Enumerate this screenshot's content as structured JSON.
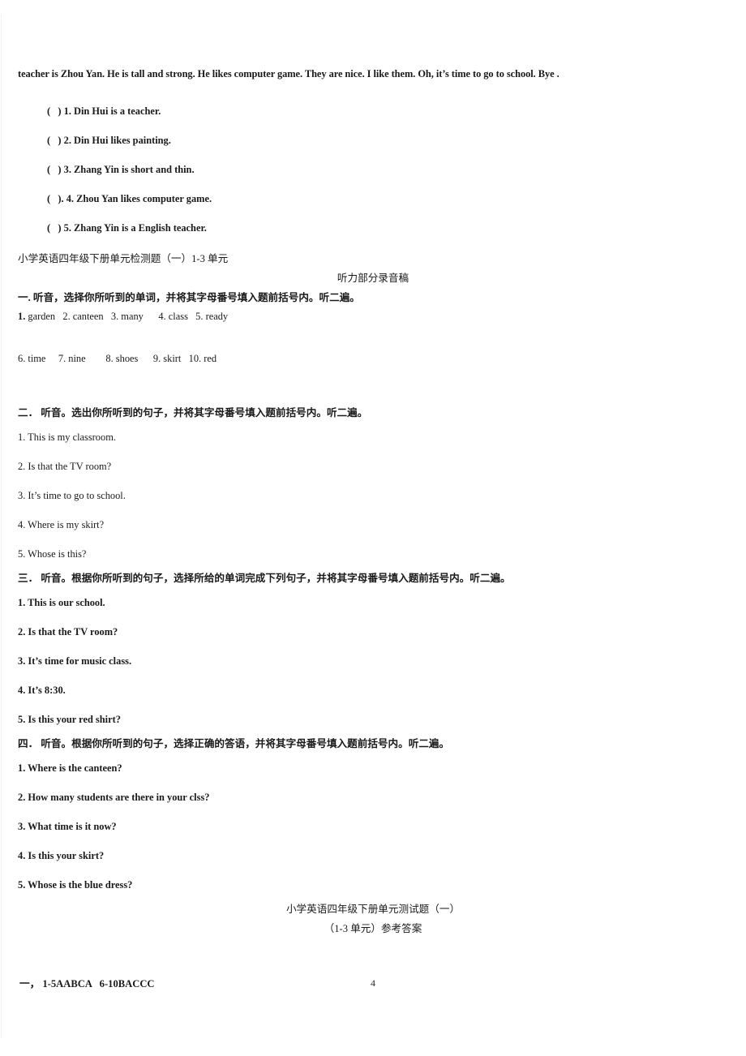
{
  "document": {
    "page_number": "4"
  },
  "passage": {
    "tail_line": "teacher is Zhou Yan. He is tall and strong. He likes computer game. They are nice. I like them. Oh, it’s time to go to school. Bye ."
  },
  "true_false": {
    "items": [
      "(   ) 1. Din Hui is a teacher.",
      "(   ) 2. Din Hui likes painting.",
      "(   ) 3. Zhang Yin is short and thin.",
      "(   ). 4. Zhou Yan likes computer game.",
      "(   ) 5. Zhang Yin is a English teacher."
    ]
  },
  "worksheet": {
    "title": "小学英语四年级下册单元检测题（一）1-3 单元",
    "script_header": "听力部分录音稿"
  },
  "sections": [
    {
      "id": "section-one",
      "directive": "一. 听音，选择你所听到的单词，并将其字母番号填入题前括号内。听二遍。",
      "word_rows": [
        {
          "lead": "1.",
          "rest": " garden   2. canteen   3. many      4. class   5. ready"
        },
        {
          "lead": "",
          "rest": "6. time     7. nine        8. shoes      9. skirt   10. red"
        }
      ]
    },
    {
      "id": "section-two",
      "directive": "二． 听音。选出你所听到的句子，并将其字母番号填入题前括号内。听二遍。",
      "bold_items": false,
      "items": [
        "1. This is my classroom.",
        "2. Is that the TV room?",
        "3. It’s time to go to school.",
        "4. Where is my skirt?",
        "5. Whose is this?"
      ]
    },
    {
      "id": "section-three",
      "directive": "三． 听音。根据你所听到的句子，选择所给的单词完成下列句子，并将其字母番号填入题前括号内。听二遍。",
      "bold_items": true,
      "items": [
        "1. This is our school.",
        "2. Is that the TV room?",
        "3. It’s time for music class.",
        "4. It’s 8:30.",
        "5. Is this your red shirt?"
      ]
    },
    {
      "id": "section-four",
      "directive": "四． 听音。根据你所听到的句子，选择正确的答语，并将其字母番号填入题前括号内。听二遍。",
      "bold_items": true,
      "items": [
        "1. Where is the canteen?",
        "2. How many students are there in your clss?",
        "3. What time is it now?",
        "4. Is this your skirt?",
        "5. Whose is the blue dress?"
      ]
    }
  ],
  "answer_key": {
    "title_line_1": "小学英语四年级下册单元测试题（一）",
    "title_line_2": "（1-3 单元）参考答案",
    "lines": [
      "一， 1-5AABCA   6-10BACCC"
    ]
  }
}
